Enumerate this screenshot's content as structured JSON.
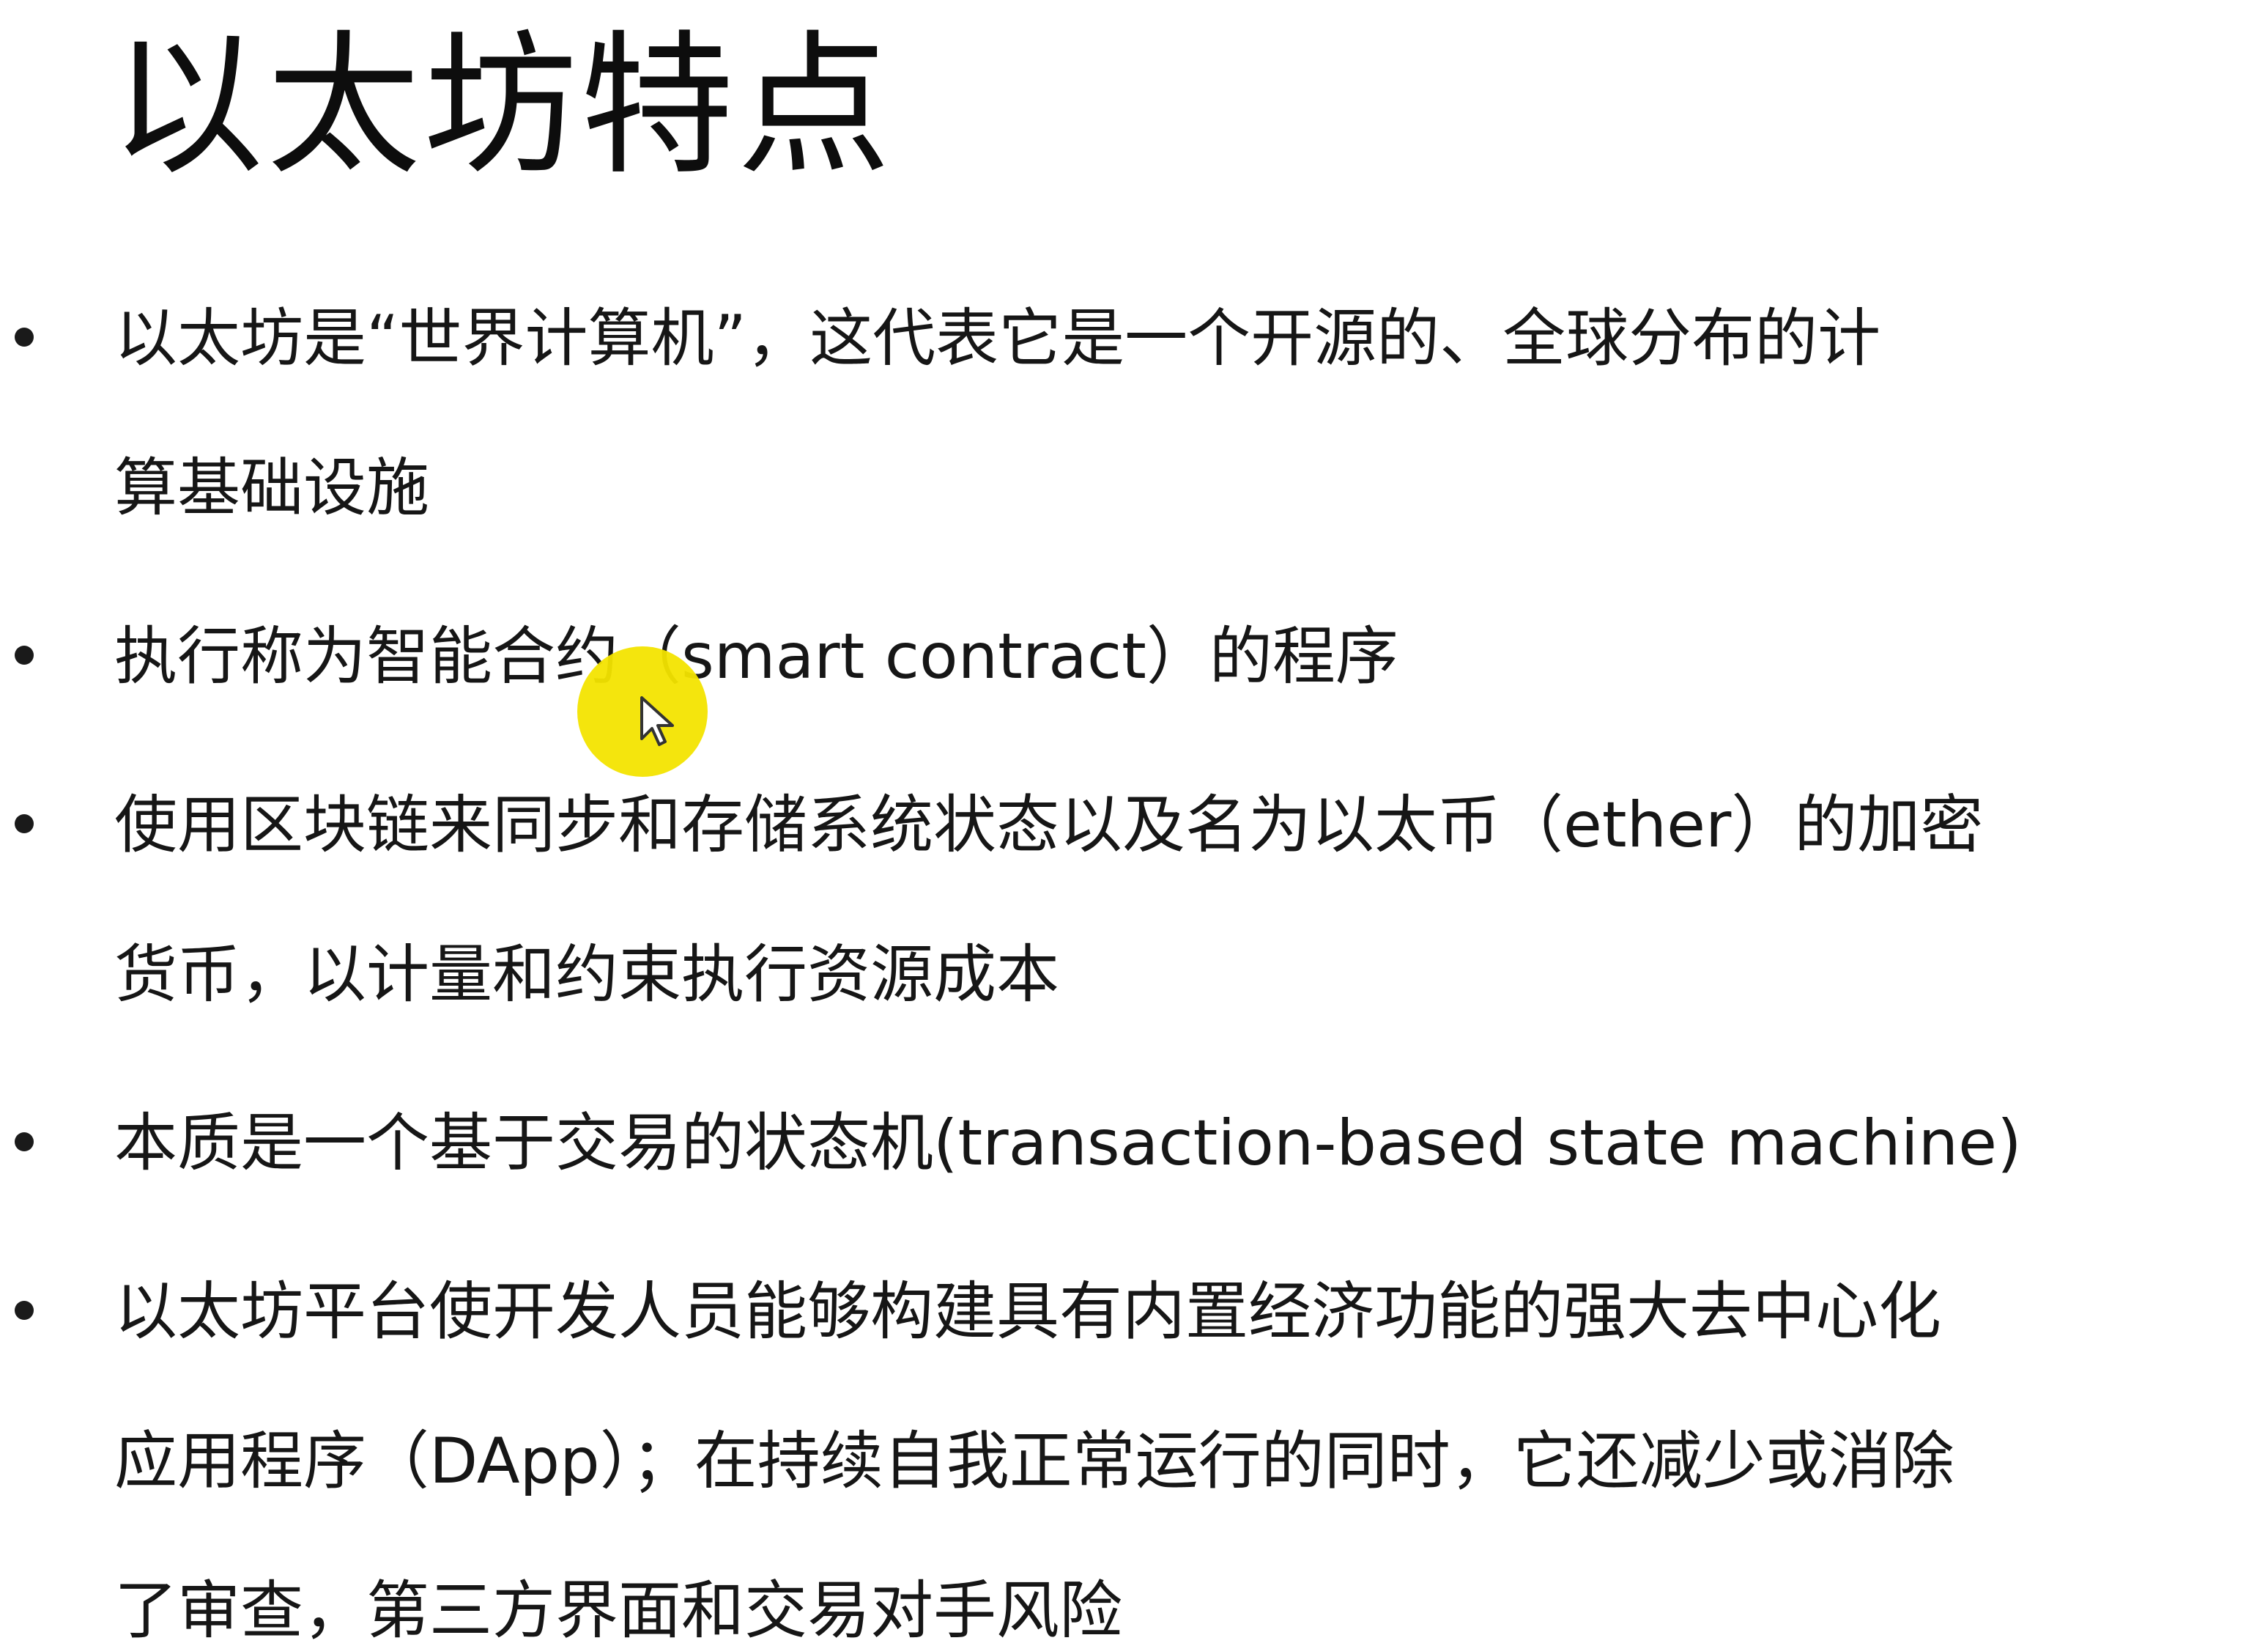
{
  "slide": {
    "title": "以太坊特点",
    "bullets": [
      {
        "lines": [
          "以太坊是“世界计算机”，这代表它是一个开源的、全球分布的计",
          "算基础设施"
        ]
      },
      {
        "lines": [
          "执行称为智能合约（smart contract）的程序"
        ]
      },
      {
        "lines": [
          "使用区块链来同步和存储系统状态以及名为以太币（ether）的加密",
          "货币，以计量和约束执行资源成本"
        ]
      },
      {
        "lines": [
          "本质是一个基于交易的状态机(transaction-based state machine)"
        ]
      },
      {
        "lines": [
          "以太坊平台使开发人员能够构建具有内置经济功能的强大去中心化",
          "应用程序（DApp）；在持续自我正常运行的同时，它还减少或消除",
          "了审查，第三方界面和交易对手风险"
        ]
      }
    ]
  },
  "cursor": {
    "icon": "mouse-pointer-icon",
    "highlight_color": "#f3e400"
  }
}
